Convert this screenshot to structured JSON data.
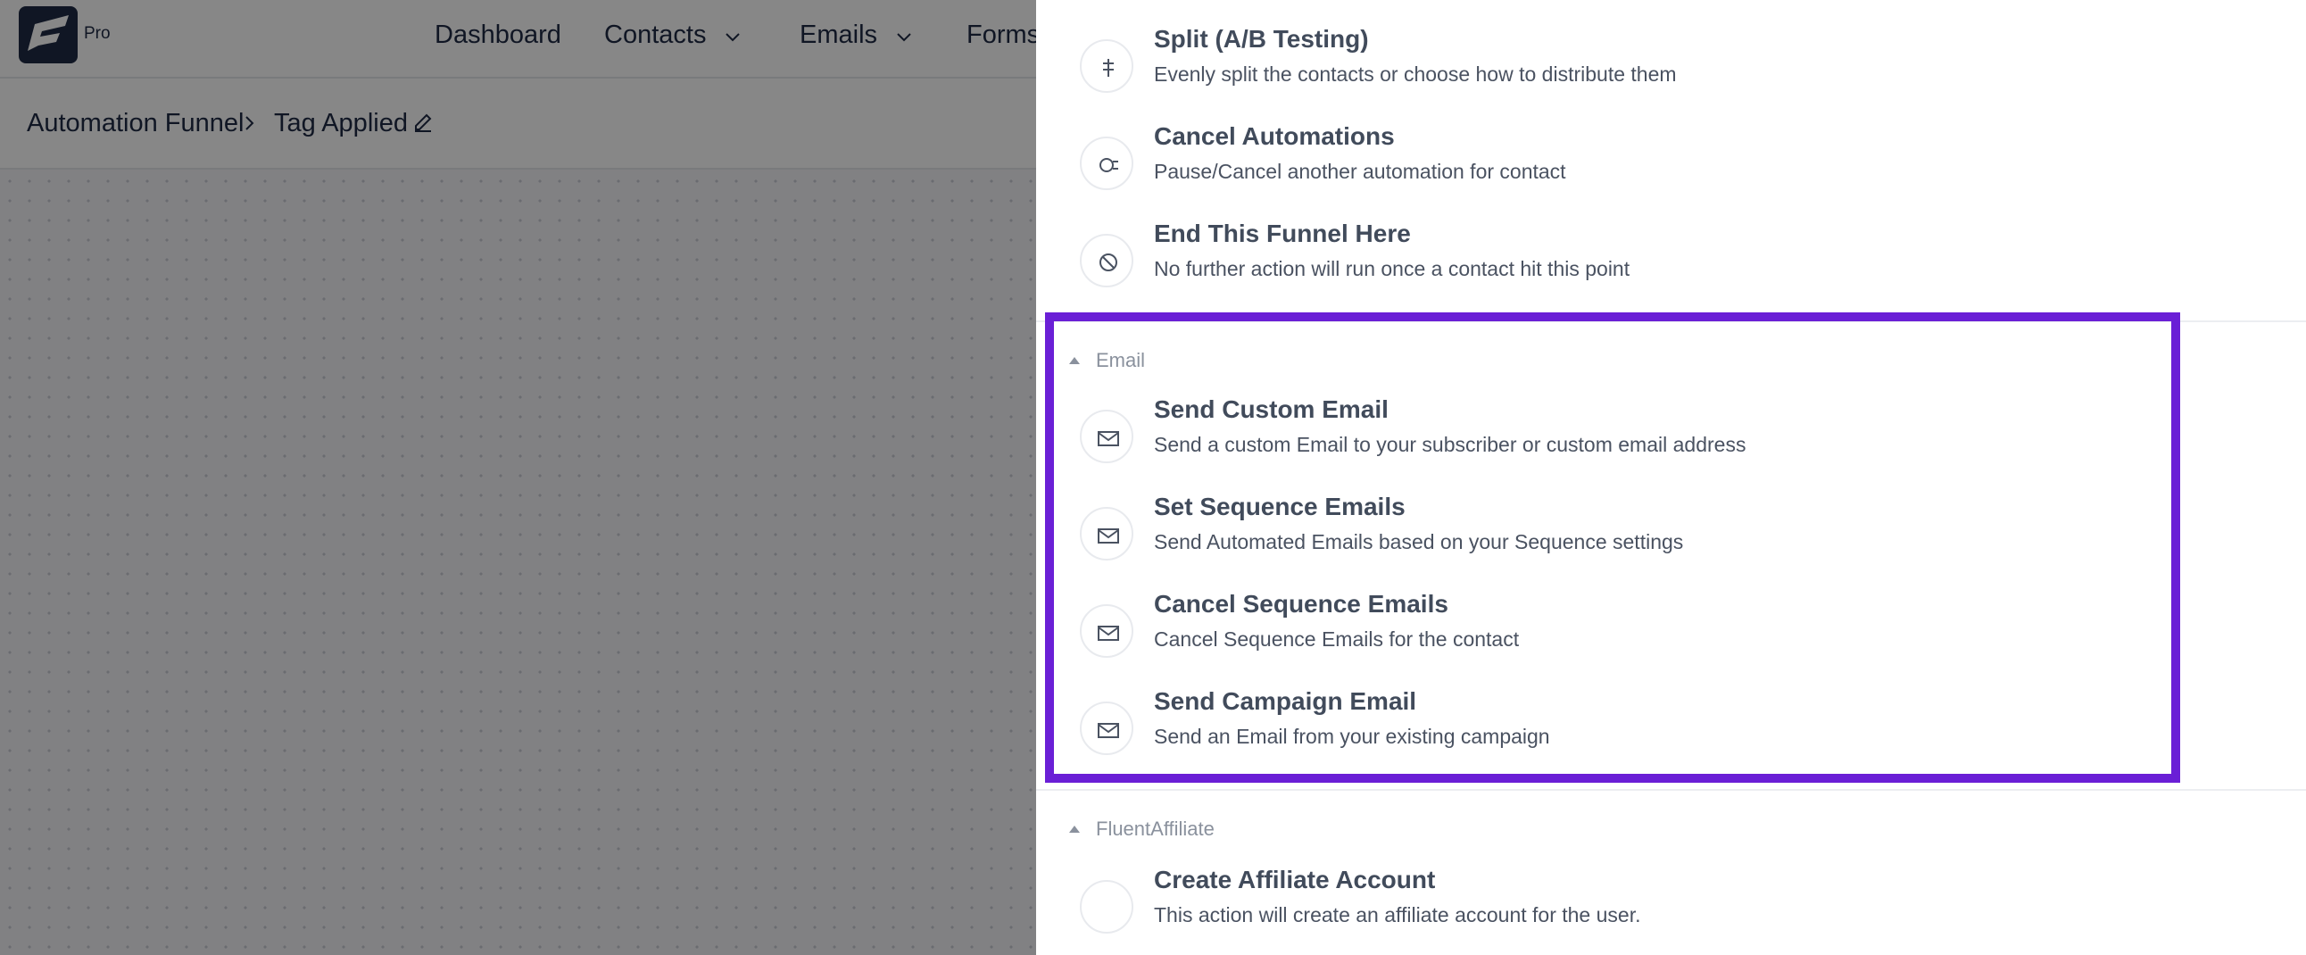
{
  "app": {
    "badge": "Pro",
    "nav": [
      {
        "label": "Dashboard",
        "has_dropdown": false
      },
      {
        "label": "Contacts",
        "has_dropdown": true
      },
      {
        "label": "Emails",
        "has_dropdown": true
      },
      {
        "label": "Forms",
        "has_dropdown": false
      }
    ],
    "breadcrumb": {
      "parent": "Automation Funnel",
      "current": "Tag Applied"
    }
  },
  "drawer": {
    "top_items": [
      {
        "title": "Split (A/B Testing)",
        "description": "Evenly split the contacts or choose how to distribute them",
        "icon": "split-icon"
      },
      {
        "title": "Cancel Automations",
        "description": "Pause/Cancel another automation for contact",
        "icon": "cancel-automation-icon"
      },
      {
        "title": "End This Funnel Here",
        "description": "No further action will run once a contact hit this point",
        "icon": "stop-icon"
      }
    ],
    "groups": [
      {
        "name": "Email",
        "highlighted": true,
        "items": [
          {
            "title": "Send Custom Email",
            "description": "Send a custom Email to your subscriber or custom email address",
            "icon": "email-send-icon"
          },
          {
            "title": "Set Sequence Emails",
            "description": "Send Automated Emails based on your Sequence settings",
            "icon": "email-sequence-icon"
          },
          {
            "title": "Cancel Sequence Emails",
            "description": "Cancel Sequence Emails for the contact",
            "icon": "email-cancel-icon"
          },
          {
            "title": "Send Campaign Email",
            "description": "Send an Email from your existing campaign",
            "icon": "email-campaign-icon"
          }
        ]
      },
      {
        "name": "FluentAffiliate",
        "highlighted": false,
        "items": [
          {
            "title": "Create Affiliate Account",
            "description": "This action will create an affiliate account for the user.",
            "icon": "affiliate-icon"
          }
        ]
      }
    ]
  },
  "colors": {
    "highlight": "#6a1fd6",
    "title_text": "#414b5b",
    "desc_text": "#4a5261",
    "brand": "#1f2a44"
  }
}
